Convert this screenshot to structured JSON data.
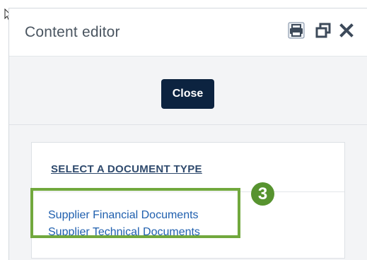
{
  "window": {
    "title": "Content editor",
    "icons": {
      "print": "print-icon",
      "restore": "restore-window-icon",
      "close": "close-icon"
    }
  },
  "toolbar": {
    "close_label": "Close"
  },
  "document_picker": {
    "heading": "SELECT A DOCUMENT TYPE",
    "items": [
      {
        "label": "Supplier Financial Documents"
      },
      {
        "label": "Supplier Technical Documents"
      }
    ]
  },
  "annotation": {
    "step_number": "3",
    "color": "#71a83d"
  },
  "colors": {
    "button_bg": "#0c2340",
    "link": "#1f5fae",
    "heading_link": "#2f4a6d",
    "title": "#4a5560"
  }
}
